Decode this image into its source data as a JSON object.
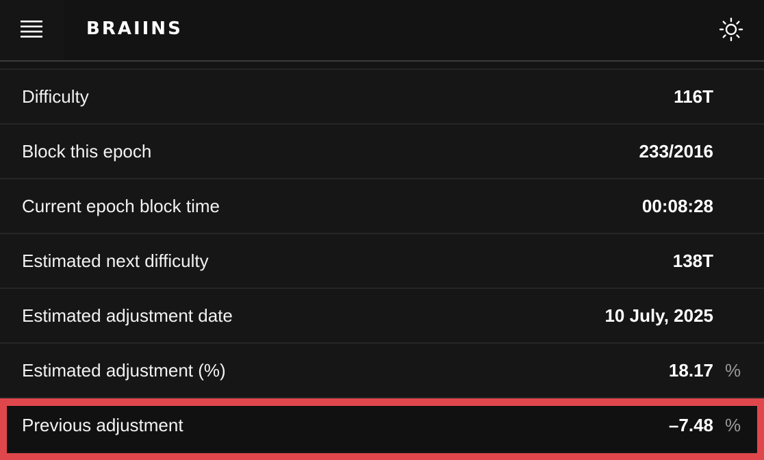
{
  "header": {
    "logo_text": "BRAIINS",
    "menu_icon": "hamburger-menu-icon",
    "theme_icon": "sun-icon"
  },
  "stats": {
    "rows": [
      {
        "label": "Difficulty",
        "value": "116T",
        "unit": ""
      },
      {
        "label": "Block this epoch",
        "value": "233/2016",
        "unit": ""
      },
      {
        "label": "Current epoch block time",
        "value": "00:08:28",
        "unit": ""
      },
      {
        "label": "Estimated next difficulty",
        "value": "138T",
        "unit": ""
      },
      {
        "label": "Estimated adjustment date",
        "value": "10 July, 2025",
        "unit": ""
      },
      {
        "label": "Estimated adjustment (%)",
        "value": "18.17",
        "unit": "%"
      },
      {
        "label": "Previous adjustment",
        "value": "–7.48",
        "unit": "%"
      }
    ]
  },
  "colors": {
    "background": "#141414",
    "highlight_border": "#e0474c",
    "unit_text": "#9a9a9a"
  }
}
